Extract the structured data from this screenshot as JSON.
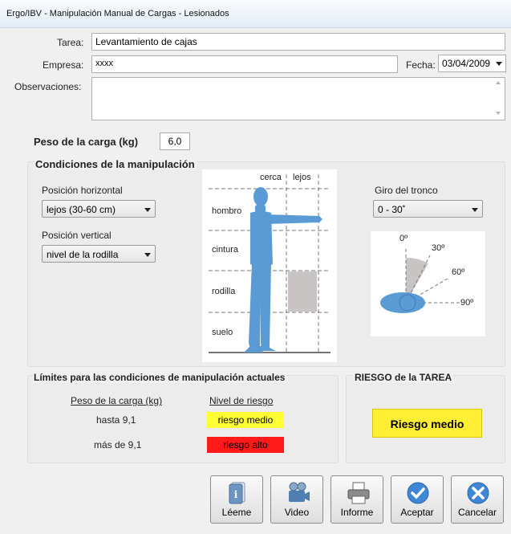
{
  "window": {
    "title": "Ergo/IBV - Manipulación Manual de Cargas - Lesionados"
  },
  "form": {
    "tarea_label": "Tarea:",
    "tarea_value": "Levantamiento de cajas",
    "empresa_label": "Empresa:",
    "empresa_value": "xxxx",
    "fecha_label": "Fecha:",
    "fecha_value": "03/04/2009",
    "obs_label": "Observaciones:",
    "obs_value": "",
    "peso_label": "Peso de la carga (kg)",
    "peso_value": "6,0"
  },
  "conditions": {
    "title": "Condiciones de la manipulación",
    "horizontal_label": "Posición horizontal",
    "horizontal_value": "lejos (30-60 cm)",
    "vertical_label": "Posición vertical",
    "vertical_value": "nivel de la rodilla",
    "giro_label": "Giro del tronco",
    "giro_value": "0 - 30˚",
    "figure": {
      "col_cerca": "cerca",
      "col_lejos": "lejos",
      "row_hombro": "hombro",
      "row_cintura": "cintura",
      "row_rodilla": "rodilla",
      "row_suelo": "suelo"
    },
    "angles": {
      "a0": "0º",
      "a30": "30º",
      "a60": "60º",
      "a90": "90º"
    }
  },
  "limits": {
    "title": "Límites para las condiciones de manipulación actuales",
    "col_peso": "Peso de la carga (kg)",
    "col_nivel": "Nivel de riesgo",
    "rows": [
      {
        "peso": "hasta 9,1",
        "nivel": "riesgo medio",
        "color": "#ffff33"
      },
      {
        "peso": "más de 9,1",
        "nivel": "riesgo alto",
        "color": "#ff1a1a"
      }
    ]
  },
  "risk": {
    "title": "RIESGO de la TAREA",
    "value": "Riesgo medio",
    "color": "#ffee33"
  },
  "buttons": {
    "leeme": "Léeme",
    "video": "Video",
    "informe": "Informe",
    "aceptar": "Aceptar",
    "cancelar": "Cancelar"
  }
}
